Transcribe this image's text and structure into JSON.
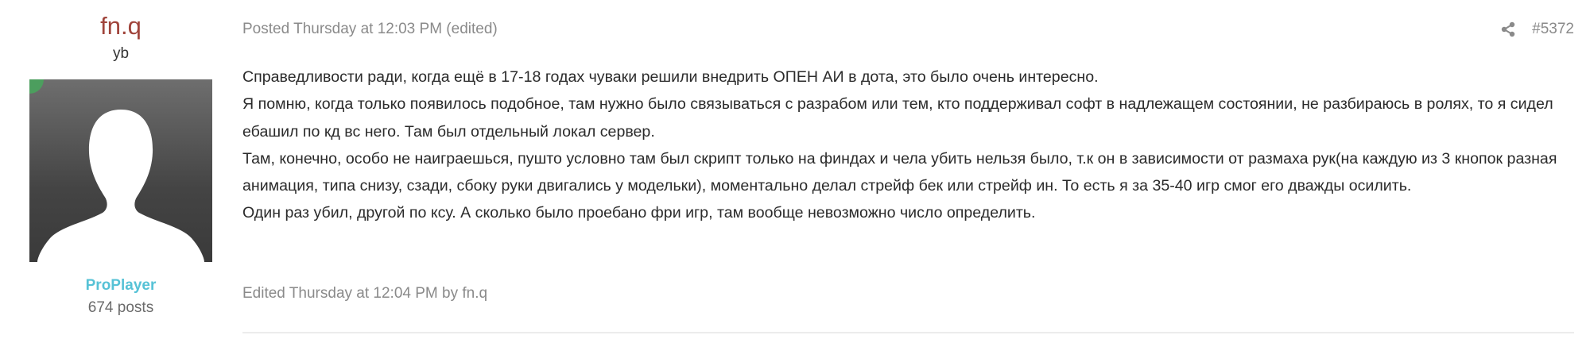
{
  "author": {
    "name": "fn.q",
    "title": "yb",
    "rank": "ProPlayer",
    "post_count": "674 posts"
  },
  "post": {
    "meta": "Posted Thursday at 12:03 PM (edited)",
    "number": "#5372",
    "share_icon": "share-icon",
    "paragraphs": [
      "Справедливости ради, когда ещё в 17-18 годах чуваки решили внедрить ОПЕН АИ в дота, это было очень интересно.",
      "Я помню, когда только появилось подобное, там нужно было связываться с разрабом или тем, кто поддерживал софт в надлежащем состоянии, не разбираюсь в ролях, то я сидел ебашил по кд вс него. Там был отдельный локал сервер.",
      "Там, конечно, особо не наиграешься, пушто условно там был скрипт только на финдах и чела убить нельзя было, т.к он в зависимости от размаха рук(на каждую из 3 кнопок разная анимация, типа снизу, сзади, сбоку руки двигались у  модельки), моментально делал стрейф бек или стрейф ин. То есть я за 35-40 игр смог его дважды осилить.",
      "Один раз убил, другой по ксу. А сколько было проебано фри игр, там вообще невозможно число определить."
    ],
    "edited_note": "Edited Thursday at 12:04 PM by fn.q"
  },
  "colors": {
    "author_name": "#a0443b",
    "rank": "#56c2d6",
    "online": "#4c9e5e",
    "meta": "#8a8a8a"
  }
}
